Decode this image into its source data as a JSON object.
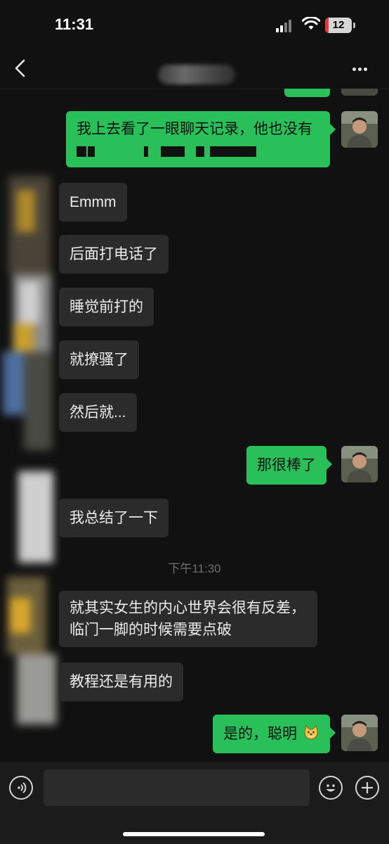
{
  "status_bar": {
    "time": "11:31",
    "battery": "12"
  },
  "nav": {
    "contact_name": ""
  },
  "messages": [
    {
      "from": "me",
      "text": "我上去看了一眼聊天记录，他也没有"
    },
    {
      "from": "them",
      "text": "Emmm"
    },
    {
      "from": "them",
      "text": "后面打电话了"
    },
    {
      "from": "them",
      "text": "睡觉前打的"
    },
    {
      "from": "them",
      "text": "就撩骚了"
    },
    {
      "from": "them",
      "text": "然后就..."
    },
    {
      "from": "me",
      "text": "那很棒了"
    },
    {
      "from": "them",
      "text": "我总结了一下"
    },
    {
      "from": "them",
      "text_line1": "就其实女生的内心世界会很有反差，",
      "text_line2": "临门一脚的时候需要点破"
    },
    {
      "from": "them",
      "text": "教程还是有用的"
    },
    {
      "from": "me",
      "text": "是的，聪明",
      "emoji": "doge"
    }
  ],
  "timestamp": "下午11:30",
  "input": {
    "placeholder": ""
  }
}
